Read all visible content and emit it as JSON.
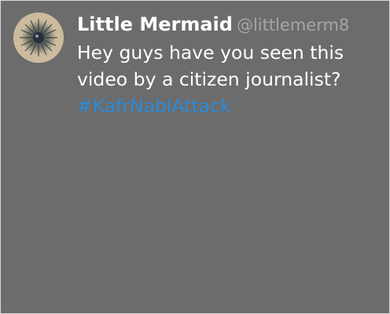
{
  "tweet": {
    "display_name": "Little Mermaid",
    "handle": "@littlemerm8",
    "text_line_1": "Hey guys have you seen this",
    "text_line_2": "video by a citizen journalist?",
    "hashtag": "#KafrNablAttack",
    "avatar_icon": "profile-photo-icon"
  },
  "colors": {
    "background": "#6c6c6c",
    "border": "#d8d8d8",
    "name": "#ffffff",
    "handle": "#a6a6a6",
    "text": "#ffffff",
    "hashtag": "#2b8ad8"
  }
}
